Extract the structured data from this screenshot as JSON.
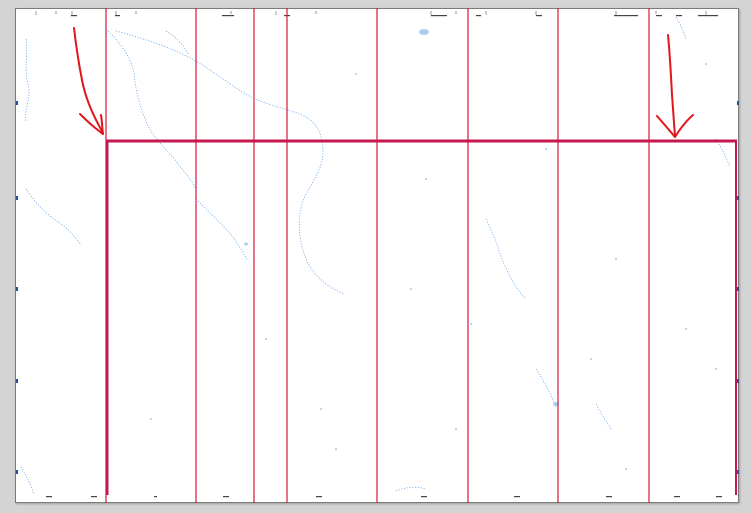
{
  "map": {
    "sheet_color": "#ffffff",
    "background_color": "#d4d4d4",
    "water_color": "#6aa7e8",
    "grid_line_color": "#d01a3a",
    "highlight_color": "#c4184f",
    "arrow_color": "#e0161c",
    "layers": [
      "rivers",
      "graticule-lines",
      "highlight-outline",
      "annotation-arrows"
    ]
  }
}
